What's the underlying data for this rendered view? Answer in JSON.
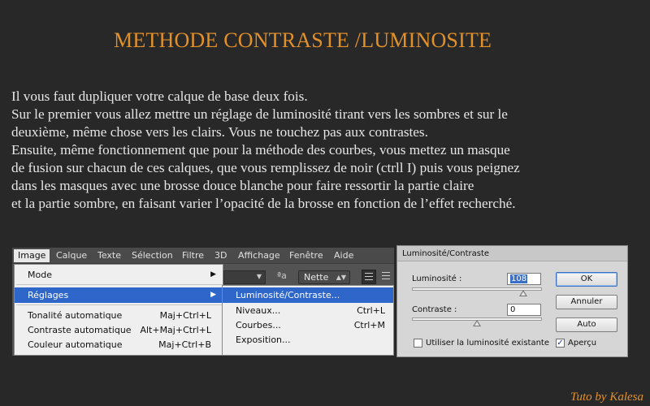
{
  "title": "METHODE CONTRASTE /LUMINOSITE",
  "paragraph_lines": [
    "Il vous faut dupliquer votre calque de base deux fois.",
    "Sur le premier vous allez mettre un réglage de luminosité tirant vers les sombres et sur le",
    "deuxième, même chose vers les clairs. Vous ne touchez pas aux contrastes.",
    "Ensuite, même fonctionnement que pour la méthode des courbes, vous mettez un masque",
    "de fusion sur chacun de ces calques, que vous remplissez de noir (ctrll I) puis vous peignez",
    "dans les masques avec une brosse douce blanche pour faire ressortir la partie claire",
    "et la partie sombre, en faisant varier l’opacité de la brosse en fonction de l’effet recherché."
  ],
  "photoshop": {
    "menubar": [
      "Image",
      "Calque",
      "Texte",
      "Sélection",
      "Filtre",
      "3D",
      "Affichage",
      "Fenêtre",
      "Aide"
    ],
    "toolbar": {
      "aa_glyph": "ªa",
      "antialias_value": "Nette"
    },
    "image_menu": {
      "mode": "Mode",
      "reglages": "Réglages",
      "tonalite": {
        "label": "Tonalité automatique",
        "shortcut": "Maj+Ctrl+L"
      },
      "contraste": {
        "label": "Contraste automatique",
        "shortcut": "Alt+Maj+Ctrl+L"
      },
      "couleur": {
        "label": "Couleur automatique",
        "shortcut": "Maj+Ctrl+B"
      }
    },
    "reglages_submenu": {
      "luminosite": {
        "label": "Luminosité/Contraste..."
      },
      "niveaux": {
        "label": "Niveaux...",
        "shortcut": "Ctrl+L"
      },
      "courbes": {
        "label": "Courbes...",
        "shortcut": "Ctrl+M"
      },
      "exposition": {
        "label": "Exposition..."
      }
    }
  },
  "dialog": {
    "title": "Luminosité/Contraste",
    "luminosite_label": "Luminosité :",
    "luminosite_value": "108",
    "contraste_label": "Contraste :",
    "contraste_value": "0",
    "ok": "OK",
    "annuler": "Annuler",
    "auto": "Auto",
    "legacy_label": "Utiliser la luminosité existante",
    "legacy_checked": false,
    "apercu_label": "Aperçu",
    "apercu_checked": true,
    "checkmark": "✓"
  },
  "credit": "Tuto by Kalesa",
  "colors": {
    "accent": "#e2912a",
    "background": "#282828",
    "highlight": "#2f66c9"
  }
}
